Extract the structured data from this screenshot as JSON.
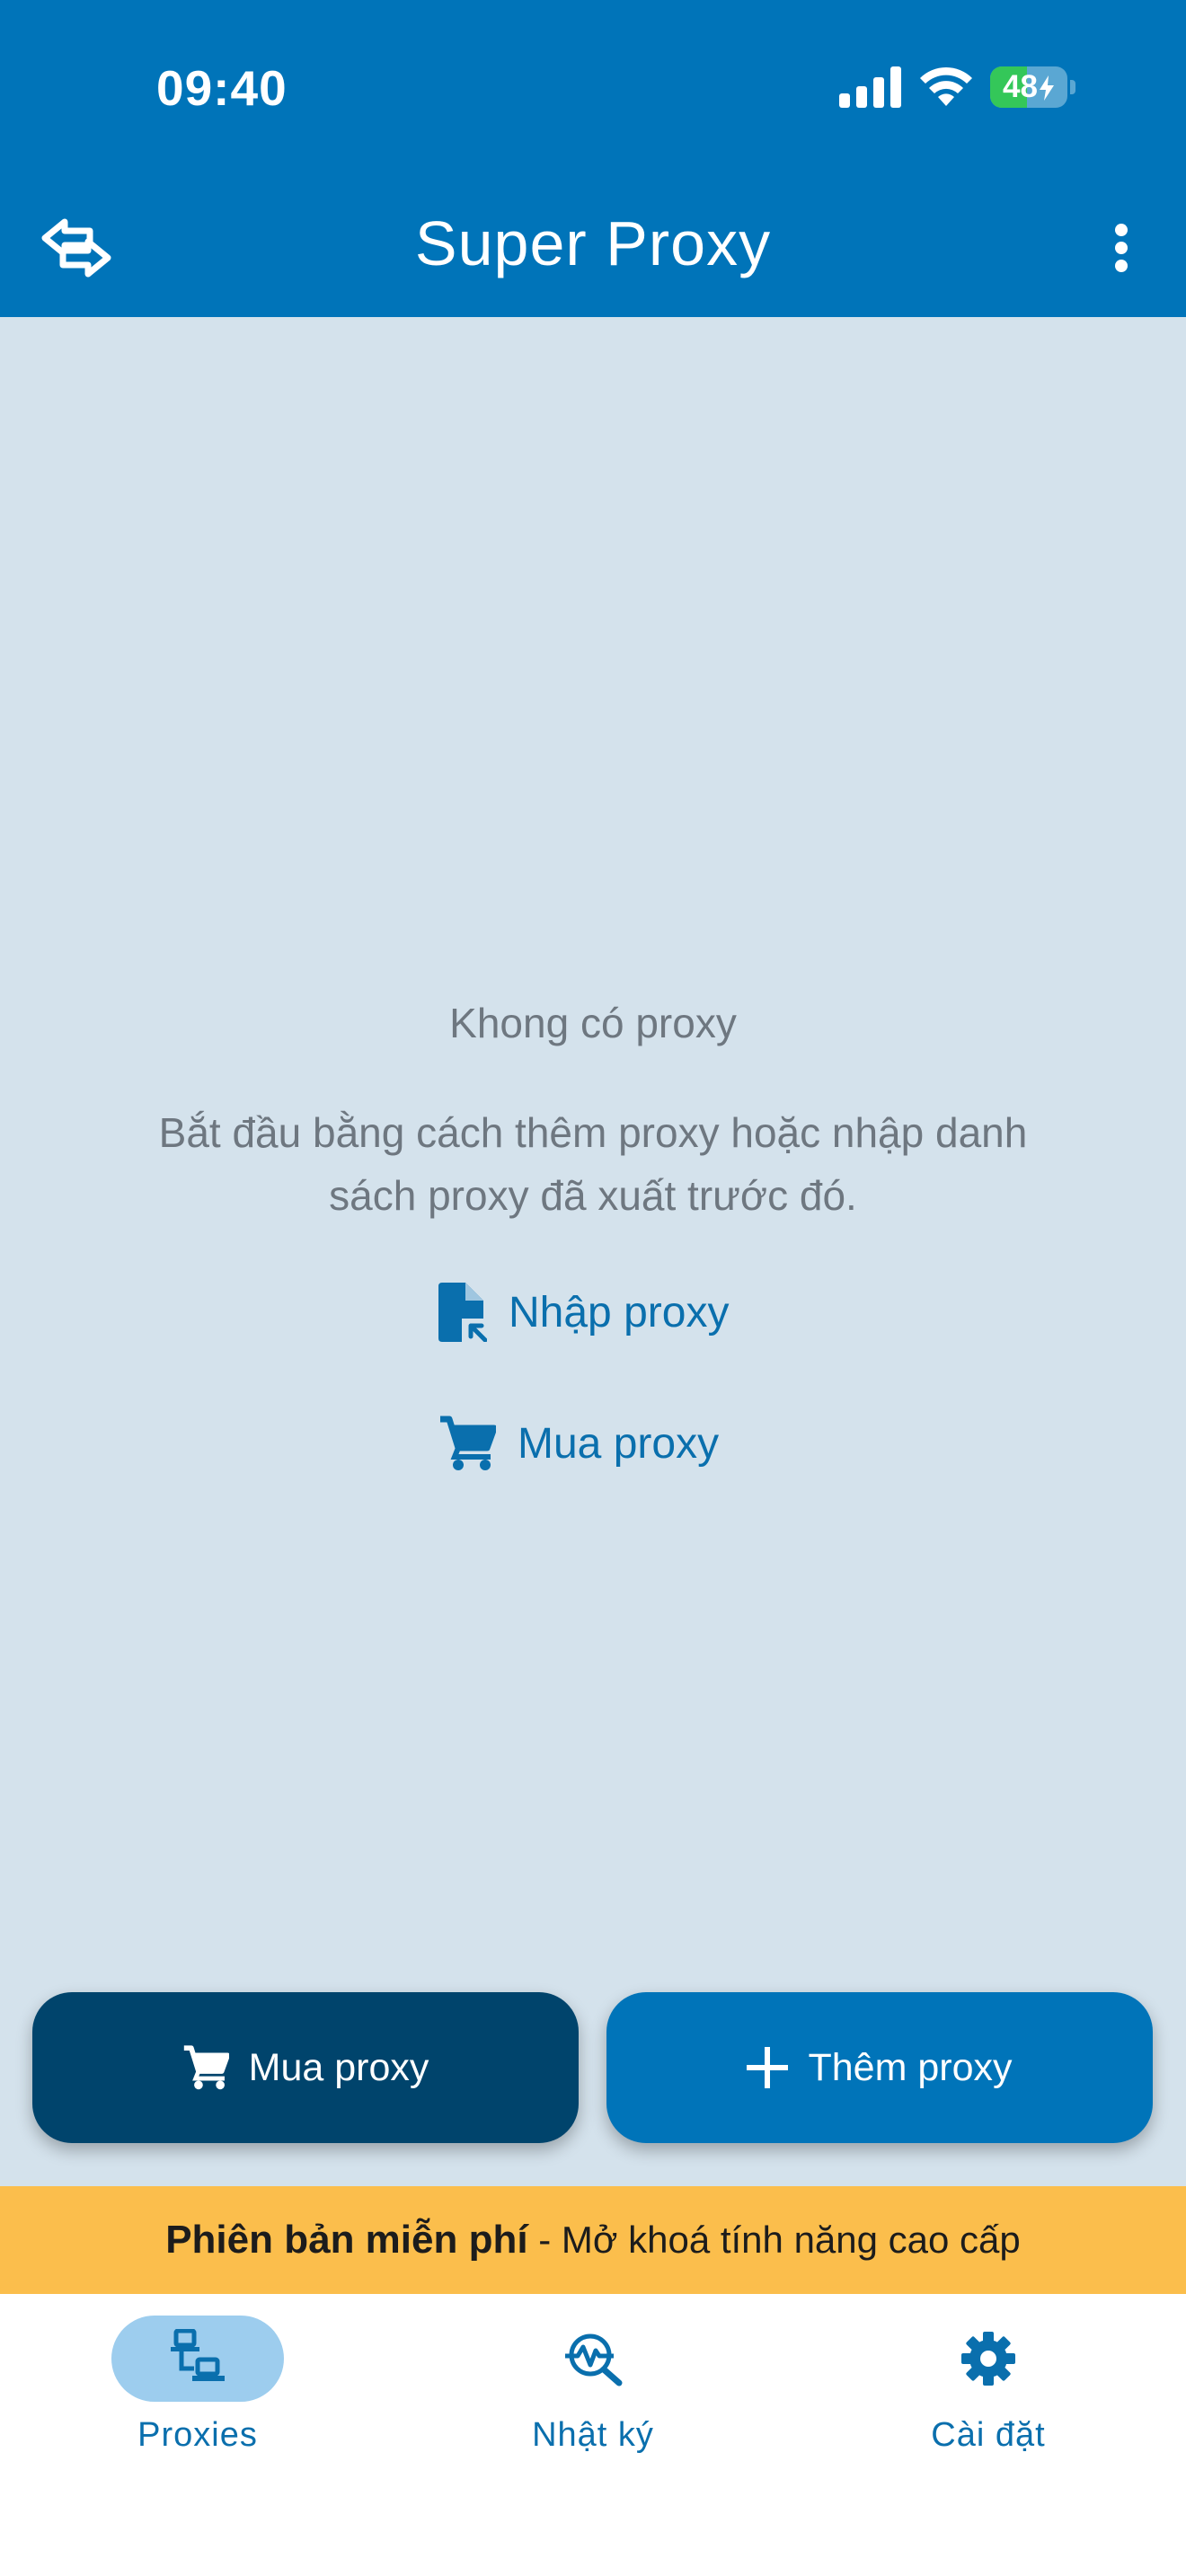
{
  "status_bar": {
    "time": "09:40",
    "battery_level": "48",
    "battery_fraction": 0.48,
    "icons": [
      "signal-icon",
      "wifi-icon",
      "battery-charging-icon"
    ]
  },
  "app_bar": {
    "title": "Super Proxy",
    "left_icon": "swap-arrows-icon",
    "right_icon": "more-vertical-icon"
  },
  "empty_state": {
    "title": "Khong có proxy",
    "description": "Bắt đầu bằng cách thêm proxy hoặc nhập danh sách proxy đã xuất trước đó.",
    "import_link": {
      "label": "Nhập proxy",
      "icon": "file-import-icon"
    },
    "buy_link": {
      "label": "Mua proxy",
      "icon": "cart-icon"
    }
  },
  "actions": {
    "buy_button": {
      "label": "Mua proxy",
      "icon": "cart-icon"
    },
    "add_button": {
      "label": "Thêm proxy",
      "icon": "plus-icon"
    }
  },
  "promo": {
    "bold": "Phiên bản miễn phí",
    "rest": "- Mở khoá tính năng cao cấp"
  },
  "bottom_nav": {
    "items": [
      {
        "label": "Proxies",
        "icon": "devices-icon",
        "active": true
      },
      {
        "label": "Nhật ký",
        "icon": "activity-search-icon",
        "active": false
      },
      {
        "label": "Cài đặt",
        "icon": "gear-icon",
        "active": false
      }
    ]
  },
  "colors": {
    "primary": "#0074b9",
    "primary_dark": "#00446c",
    "background": "#d4e2ec",
    "link": "#0a6fad",
    "promo": "#fbbe4c",
    "nav_active_pill": "#9dcdee"
  }
}
